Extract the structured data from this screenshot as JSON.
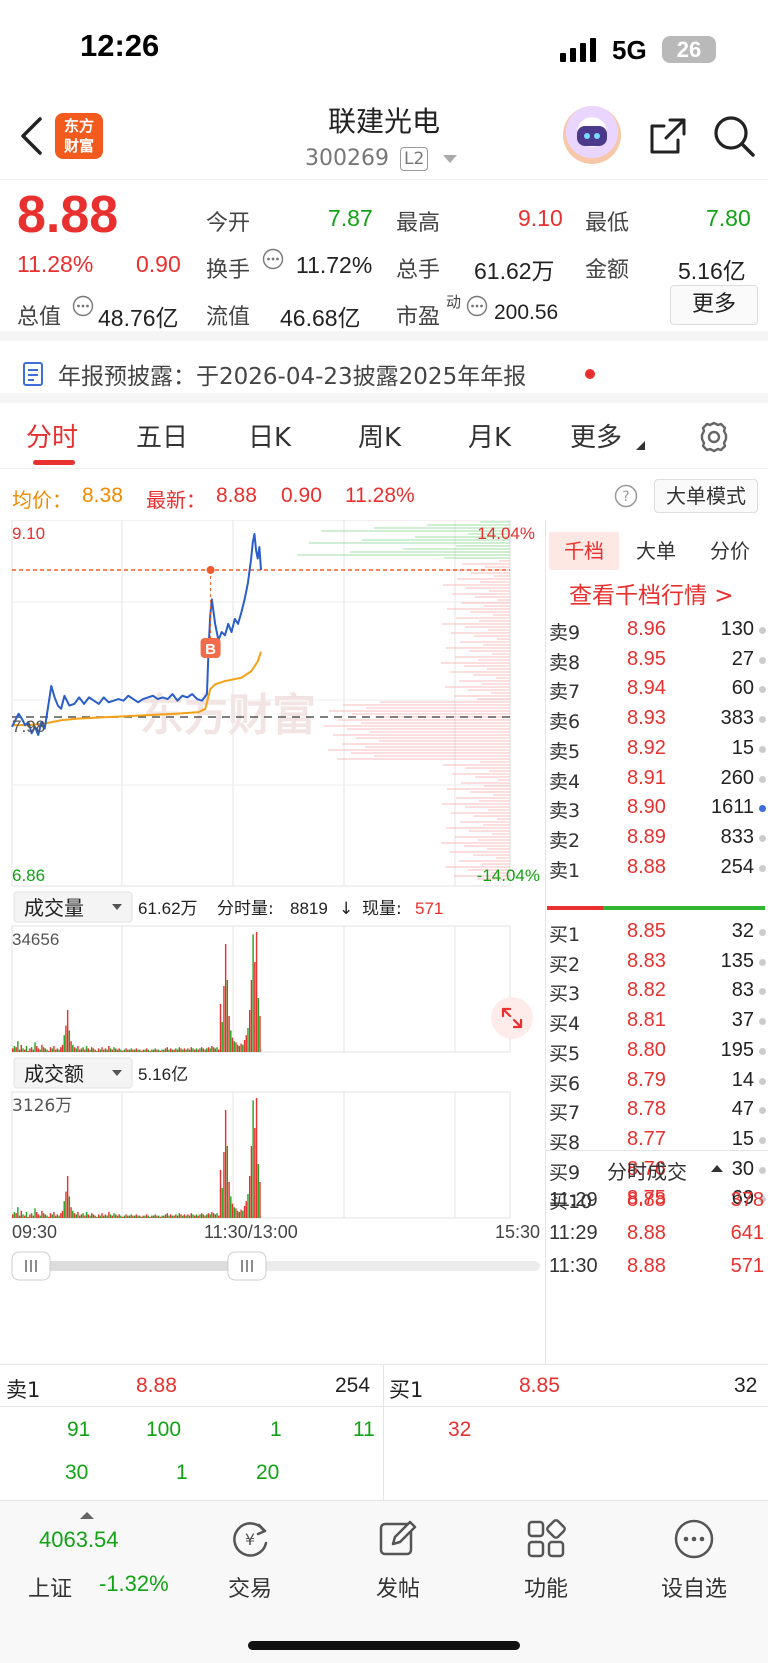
{
  "status_bar": {
    "time": "12:26",
    "network": "5G",
    "battery": "26"
  },
  "header": {
    "logo_line1": "东方",
    "logo_line2": "财富",
    "stock_name": "联建光电",
    "stock_code": "300269",
    "level_badge": "L2"
  },
  "quote": {
    "price": "8.88",
    "change_pct": "11.28%",
    "change": "0.90",
    "open_label": "今开",
    "open": "7.87",
    "high_label": "最高",
    "high": "9.10",
    "low_label": "最低",
    "low": "7.80",
    "turnover_label": "换手",
    "turnover": "11.72%",
    "volume_label": "总手",
    "volume": "61.62万",
    "amount_label": "金额",
    "amount": "5.16亿",
    "mktcap_label": "总值",
    "mktcap": "48.76亿",
    "float_label": "流值",
    "float": "46.68亿",
    "pe_label": "市盈",
    "pe_sup": "动",
    "pe": "200.56",
    "more_button": "更多"
  },
  "notice": {
    "text": "年报预披露：于2026-04-23披露2025年年报"
  },
  "tabs": [
    "分时",
    "五日",
    "日K",
    "周K",
    "月K",
    "更多"
  ],
  "info_line": {
    "avg_label": "均价：",
    "avg": "8.38",
    "latest_label": "最新：",
    "latest": "8.88",
    "change": "0.90",
    "change_pct": "11.28%",
    "big_order_button": "大单模式"
  },
  "chart_data": {
    "type": "line",
    "title": "",
    "price_axis": {
      "max": "9.10",
      "min": "6.86",
      "pct_max": "14.04%",
      "pct_min": "-14.04%",
      "pre_close_label": "7.98",
      "pre_close": 7.98
    },
    "x_ticks": [
      "09:30",
      "11:30/13:00",
      "15:30"
    ],
    "watermark": "东方财富",
    "marker": "B",
    "series": [
      {
        "name": "",
        "color": "#2a5ec8",
        "x": [
          0,
          2,
          4,
          6,
          8,
          10,
          12,
          14,
          16,
          18,
          20,
          22,
          24,
          26,
          28,
          30,
          32,
          35,
          38,
          41,
          44,
          47,
          50,
          53,
          56,
          59,
          62,
          65,
          68,
          71,
          74,
          77,
          80,
          83,
          86,
          89,
          92,
          95,
          98,
          101,
          104,
          107,
          110,
          113,
          116,
          119,
          120,
          121,
          122,
          124,
          126,
          128,
          130,
          132,
          134,
          136,
          138,
          140,
          142,
          144,
          146,
          147,
          148,
          149,
          150,
          151,
          152
        ],
        "y": [
          7.92,
          7.96,
          8.0,
          7.97,
          7.93,
          7.95,
          7.88,
          7.92,
          7.87,
          7.95,
          7.91,
          8.04,
          8.17,
          8.1,
          8.05,
          8.03,
          8.11,
          8.05,
          8.06,
          8.1,
          8.06,
          8.1,
          8.08,
          8.06,
          8.1,
          8.07,
          8.08,
          8.09,
          8.08,
          8.11,
          8.09,
          8.07,
          8.09,
          8.1,
          8.11,
          8.09,
          8.1,
          8.09,
          8.12,
          8.08,
          8.11,
          8.1,
          8.12,
          8.09,
          8.08,
          8.12,
          8.4,
          8.6,
          8.7,
          8.55,
          8.45,
          8.5,
          8.48,
          8.55,
          8.5,
          8.58,
          8.55,
          8.62,
          8.7,
          8.8,
          8.95,
          9.05,
          9.1,
          9.0,
          8.95,
          9.02,
          8.88
        ]
      },
      {
        "name": "",
        "color": "#f3a117",
        "x": [
          0,
          10,
          20,
          30,
          40,
          60,
          80,
          100,
          114,
          118,
          121,
          124,
          130,
          140,
          146,
          150,
          152
        ],
        "y": [
          7.93,
          7.93,
          7.94,
          7.96,
          7.97,
          7.98,
          7.99,
          8.0,
          8.01,
          8.03,
          8.15,
          8.18,
          8.2,
          8.22,
          8.26,
          8.32,
          8.38
        ]
      }
    ],
    "volume": {
      "label": "成交量",
      "total": "61.62万",
      "minute_label": "分时量:",
      "minute": "8819",
      "arrow": "↓",
      "current_label": "现量:",
      "current": "571",
      "max": "34656",
      "values": [
        3,
        5,
        4,
        9,
        2,
        6,
        3,
        2,
        5,
        1,
        3,
        4,
        2,
        8,
        5,
        3,
        2,
        6,
        4,
        3,
        2,
        1,
        4,
        3,
        5,
        2,
        3,
        2,
        4,
        6,
        14,
        22,
        35,
        18,
        9,
        6,
        4,
        3,
        5,
        2,
        3,
        4,
        2,
        5,
        3,
        2,
        4,
        3,
        2,
        1,
        3,
        2,
        4,
        2,
        3,
        2,
        5,
        3,
        2,
        4,
        3,
        2,
        3,
        2,
        1,
        2,
        3,
        2,
        2,
        3,
        2,
        2,
        3,
        2,
        2,
        1,
        2,
        2,
        3,
        2,
        1,
        2,
        2,
        3,
        2,
        2,
        1,
        2,
        2,
        3,
        4,
        2,
        3,
        2,
        2,
        3,
        2,
        4,
        3,
        2,
        3,
        2,
        3,
        2,
        4,
        3,
        2,
        3,
        2,
        3,
        4,
        3,
        2,
        3,
        4,
        3,
        5,
        4,
        3,
        4,
        2,
        40,
        25,
        55,
        90,
        60,
        30,
        18,
        12,
        9,
        8,
        6,
        5,
        7,
        6,
        10,
        14,
        20,
        35,
        60,
        98,
        75,
        100,
        45,
        30
      ],
      "colors": [
        "r",
        "g",
        "r",
        "g",
        "r",
        "r",
        "g",
        "r",
        "g",
        "r",
        "r",
        "g",
        "r",
        "g",
        "r",
        "r",
        "g",
        "r",
        "g",
        "r",
        "g",
        "r",
        "r",
        "g",
        "r",
        "g",
        "r",
        "g",
        "r",
        "r",
        "g",
        "r",
        "r",
        "g",
        "r",
        "g",
        "r",
        "g",
        "r",
        "g",
        "r",
        "g",
        "r",
        "g",
        "r",
        "g",
        "r",
        "g",
        "r",
        "g",
        "r",
        "g",
        "r",
        "g",
        "r",
        "g",
        "r",
        "g",
        "r",
        "g",
        "r",
        "g",
        "r",
        "g",
        "r",
        "g",
        "r",
        "g",
        "r",
        "g",
        "r",
        "g",
        "r",
        "g",
        "r",
        "g",
        "r",
        "g",
        "r",
        "g",
        "r",
        "g",
        "r",
        "g",
        "r",
        "g",
        "r",
        "g",
        "r",
        "g",
        "r",
        "g",
        "r",
        "g",
        "r",
        "g",
        "r",
        "g",
        "r",
        "g",
        "r",
        "g",
        "r",
        "g",
        "r",
        "g",
        "r",
        "g",
        "r",
        "g",
        "r",
        "g",
        "r",
        "g",
        "r",
        "g",
        "r",
        "g",
        "r",
        "g",
        "r",
        "r",
        "g",
        "r",
        "r",
        "g",
        "r",
        "g",
        "r",
        "g",
        "r",
        "g",
        "r",
        "r",
        "g",
        "r",
        "r",
        "g",
        "r",
        "r",
        "g",
        "r",
        "r",
        "g"
      ]
    },
    "amount": {
      "label": "成交额",
      "total": "5.16亿",
      "max": "3126万"
    }
  },
  "order_book": {
    "tabs": [
      "千档",
      "大单",
      "分价"
    ],
    "link": "查看千档行情 >",
    "asks": [
      {
        "label": "卖9",
        "price": "8.96",
        "vol": "130"
      },
      {
        "label": "卖8",
        "price": "8.95",
        "vol": "27"
      },
      {
        "label": "卖7",
        "price": "8.94",
        "vol": "60"
      },
      {
        "label": "卖6",
        "price": "8.93",
        "vol": "383"
      },
      {
        "label": "卖5",
        "price": "8.92",
        "vol": "15"
      },
      {
        "label": "卖4",
        "price": "8.91",
        "vol": "260"
      },
      {
        "label": "卖3",
        "price": "8.90",
        "vol": "1611"
      },
      {
        "label": "卖2",
        "price": "8.89",
        "vol": "833"
      },
      {
        "label": "卖1",
        "price": "8.88",
        "vol": "254"
      }
    ],
    "bids": [
      {
        "label": "买1",
        "price": "8.85",
        "vol": "32"
      },
      {
        "label": "买2",
        "price": "8.83",
        "vol": "135"
      },
      {
        "label": "买3",
        "price": "8.82",
        "vol": "83"
      },
      {
        "label": "买4",
        "price": "8.81",
        "vol": "37"
      },
      {
        "label": "买5",
        "price": "8.80",
        "vol": "195"
      },
      {
        "label": "买6",
        "price": "8.79",
        "vol": "14"
      },
      {
        "label": "买7",
        "price": "8.78",
        "vol": "47"
      },
      {
        "label": "买8",
        "price": "8.77",
        "vol": "15"
      },
      {
        "label": "买9",
        "price": "8.76",
        "vol": "30"
      },
      {
        "label": "买10",
        "price": "8.75",
        "vol": "69"
      }
    ],
    "ticks_title": "分时成交",
    "ticks": [
      {
        "time": "11:29",
        "price": "8.88",
        "vol": "378"
      },
      {
        "time": "11:29",
        "price": "8.88",
        "vol": "641"
      },
      {
        "time": "11:30",
        "price": "8.88",
        "vol": "571"
      }
    ]
  },
  "level1": {
    "ask_label": "卖1",
    "ask_price": "8.88",
    "ask_vol": "254",
    "bid_label": "买1",
    "bid_price": "8.85",
    "bid_vol": "32",
    "ask_queue_row1": [
      "91",
      "100",
      "1",
      "11"
    ],
    "ask_queue_row2": [
      "30",
      "1",
      "20"
    ],
    "bid_queue": [
      "32"
    ]
  },
  "bottom_nav": {
    "index_value": "4063.54",
    "index_name": "上证",
    "index_change": "-1.32%",
    "items": [
      "交易",
      "发帖",
      "功能",
      "设自选"
    ]
  }
}
